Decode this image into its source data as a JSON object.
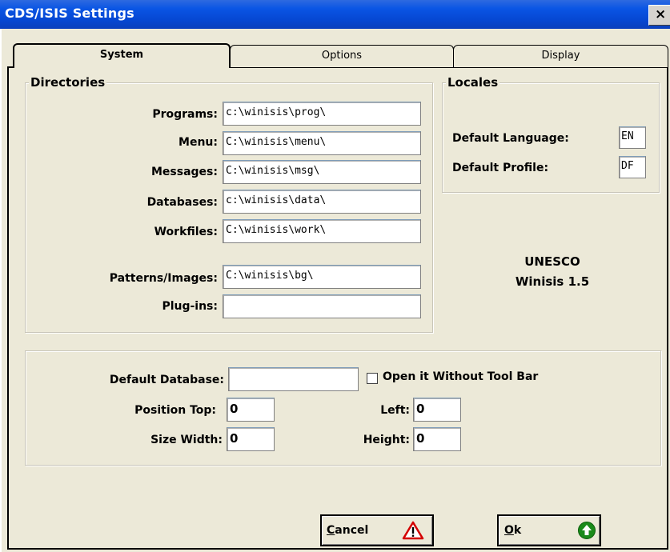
{
  "window": {
    "title": "CDS/ISIS Settings",
    "close_glyph": "×"
  },
  "tabs": [
    {
      "label": "System",
      "active": true
    },
    {
      "label": "Options",
      "active": false
    },
    {
      "label": "Display",
      "active": false
    }
  ],
  "directories": {
    "title": "Directories",
    "programs_label": "Programs:",
    "programs_value": "c:\\winisis\\prog\\",
    "menu_label": "Menu:",
    "menu_value": "C:\\winisis\\menu\\",
    "messages_label": "Messages:",
    "messages_value": "C:\\winisis\\msg\\",
    "databases_label": "Databases:",
    "databases_value": "c:\\winisis\\data\\",
    "workfiles_label": "Workfiles:",
    "workfiles_value": "C:\\winisis\\work\\",
    "patterns_label": "Patterns/Images:",
    "patterns_value": "C:\\winisis\\bg\\",
    "plugins_label": "Plug-ins:",
    "plugins_value": ""
  },
  "locales": {
    "title": "Locales",
    "language_label": "Default Language:",
    "language_value": "EN",
    "profile_label": "Default Profile:",
    "profile_value": "DF"
  },
  "about": {
    "line1": "UNESCO",
    "line2": "Winisis 1.5"
  },
  "database": {
    "default_label": "Default Database:",
    "default_value": "",
    "checkbox_label": "Open it Without Tool Bar",
    "checkbox_checked": false,
    "top_label": "Position Top:",
    "top_value": "0",
    "left_label": "Left:",
    "left_value": "0",
    "width_label": "Size Width:",
    "width_value": "0",
    "height_label": "Height:",
    "height_value": "0"
  },
  "buttons": {
    "cancel_underline": "C",
    "cancel_rest": "ancel",
    "ok_underline": "O",
    "ok_rest": "k"
  },
  "colors": {
    "titlebar": "#0a55e4",
    "dialog_bg": "#ECE9D8",
    "warning_red": "#d40000",
    "ok_green": "#1a8a1a"
  },
  "icons": {
    "cancel": "warning-icon",
    "ok": "up-arrow-circle-icon"
  }
}
